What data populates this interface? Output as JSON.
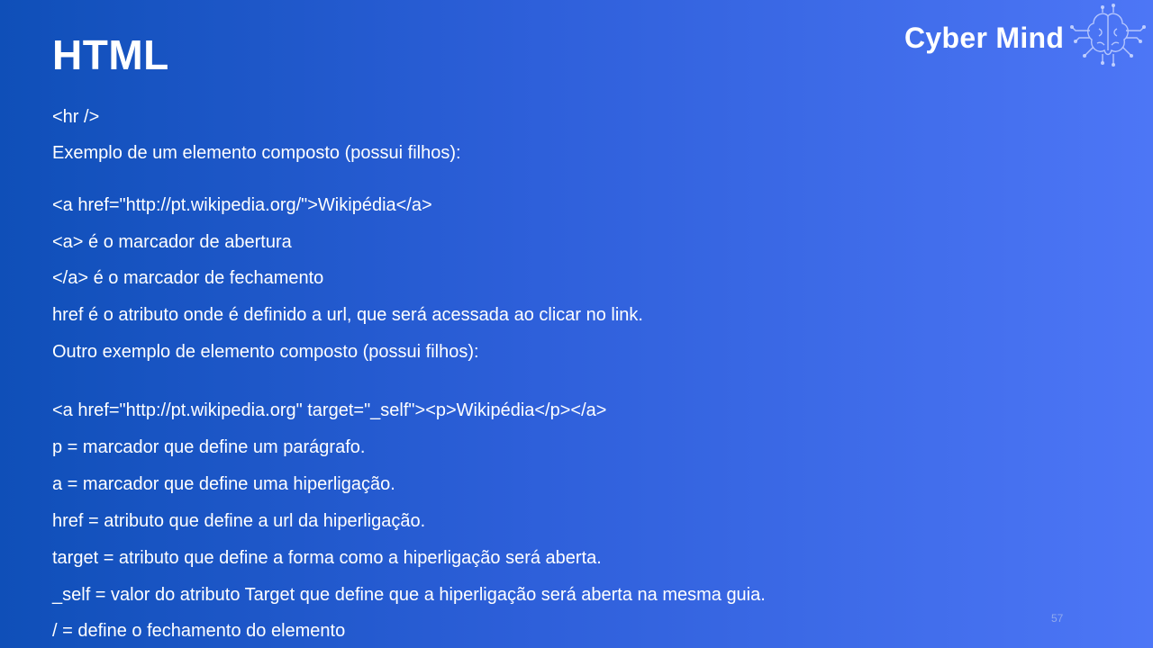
{
  "slide": {
    "title": "HTML",
    "logo_text": "Cyber Mind",
    "page_number": "57",
    "lines": [
      "<hr />",
      "Exemplo de um elemento composto (possui filhos):",
      "<a href=\"http://pt.wikipedia.org/\">Wikipédia</a>",
      "<a> é o marcador de abertura",
      "</a> é o marcador de fechamento",
      "href é o atributo onde é definido a url, que será acessada ao clicar no link.",
      "Outro exemplo de elemento composto (possui filhos):",
      "<a href=\"http://pt.wikipedia.org\"  target=\"_self\"><p>Wikipédia</p></a>",
      "p = marcador que define um parágrafo.",
      "a = marcador que define uma hiperligação.",
      "href = atributo que define a url da hiperligação.",
      "target = atributo que define a forma como a hiperligação será aberta.",
      "_self = valor do atributo Target que define que a hiperligação será aberta na mesma guia.",
      "/ = define o fechamento do elemento"
    ]
  }
}
